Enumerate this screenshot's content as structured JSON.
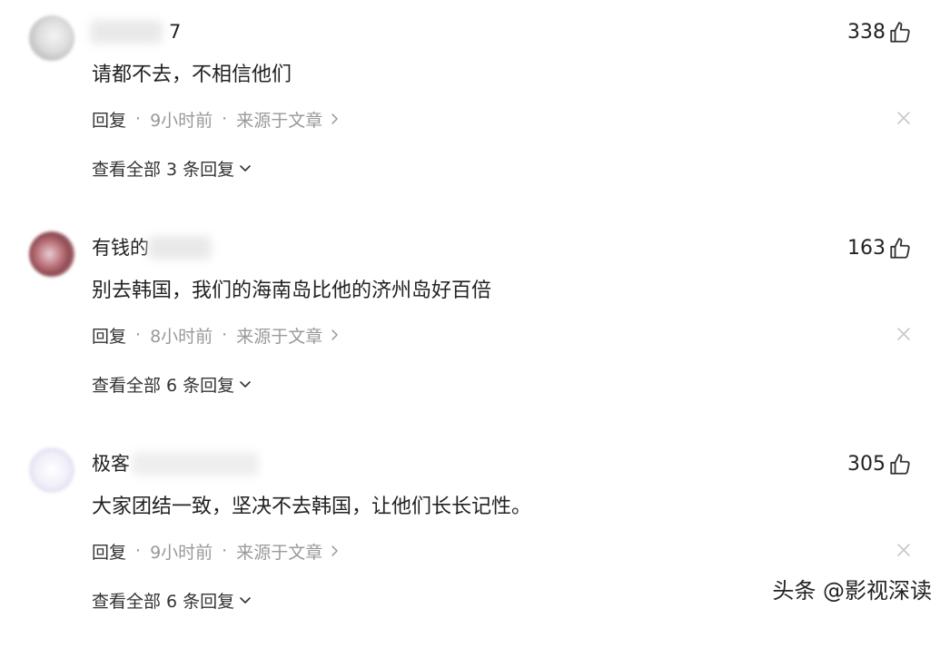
{
  "comments": [
    {
      "username": "7",
      "likes": "338",
      "text": "请都不去，不相信他们",
      "reply_label": "回复",
      "time": "9小时前",
      "source": "来源于文章",
      "view_replies": "查看全部 3 条回复"
    },
    {
      "username": "有钱的",
      "likes": "163",
      "text": "别去韩国，我们的海南岛比他的济州岛好百倍",
      "reply_label": "回复",
      "time": "8小时前",
      "source": "来源于文章",
      "view_replies": "查看全部 6 条回复"
    },
    {
      "username": "极客",
      "likes": "305",
      "text": "大家团结一致，坚决不去韩国，让他们长长记性。",
      "reply_label": "回复",
      "time": "9小时前",
      "source": "来源于文章",
      "view_replies": "查看全部 6 条回复"
    }
  ],
  "separator": "·",
  "watermark": "头条 @影视深读",
  "colors": {
    "text": "#222222",
    "meta": "#999999",
    "icon": "#333333",
    "close": "#c8c8c8"
  }
}
